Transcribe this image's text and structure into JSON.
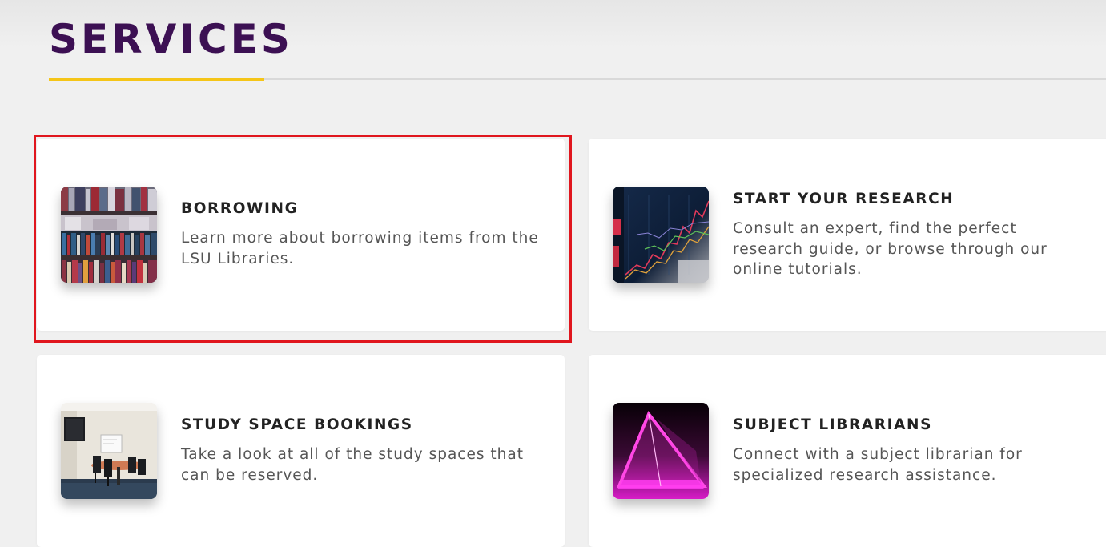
{
  "section": {
    "title": "SERVICES"
  },
  "colors": {
    "title": "#3c1053",
    "accent": "#f5c518",
    "highlight": "#e0161e"
  },
  "cards": [
    {
      "title": "BORROWING",
      "description": "Learn more about borrowing items from the LSU Libraries.",
      "image": "bookshelf-photo"
    },
    {
      "title": "START YOUR RESEARCH",
      "description": "Consult an expert, find the perfect research guide, or browse through our online tutorials.",
      "image": "stock-chart-photo"
    },
    {
      "title": "STUDY SPACE BOOKINGS",
      "description": "Take a look at all of the study spaces that can be reserved.",
      "image": "study-room-photo"
    },
    {
      "title": "SUBJECT LIBRARIANS",
      "description": "Connect with a subject librarian for specialized research assistance.",
      "image": "prism-photo"
    }
  ]
}
